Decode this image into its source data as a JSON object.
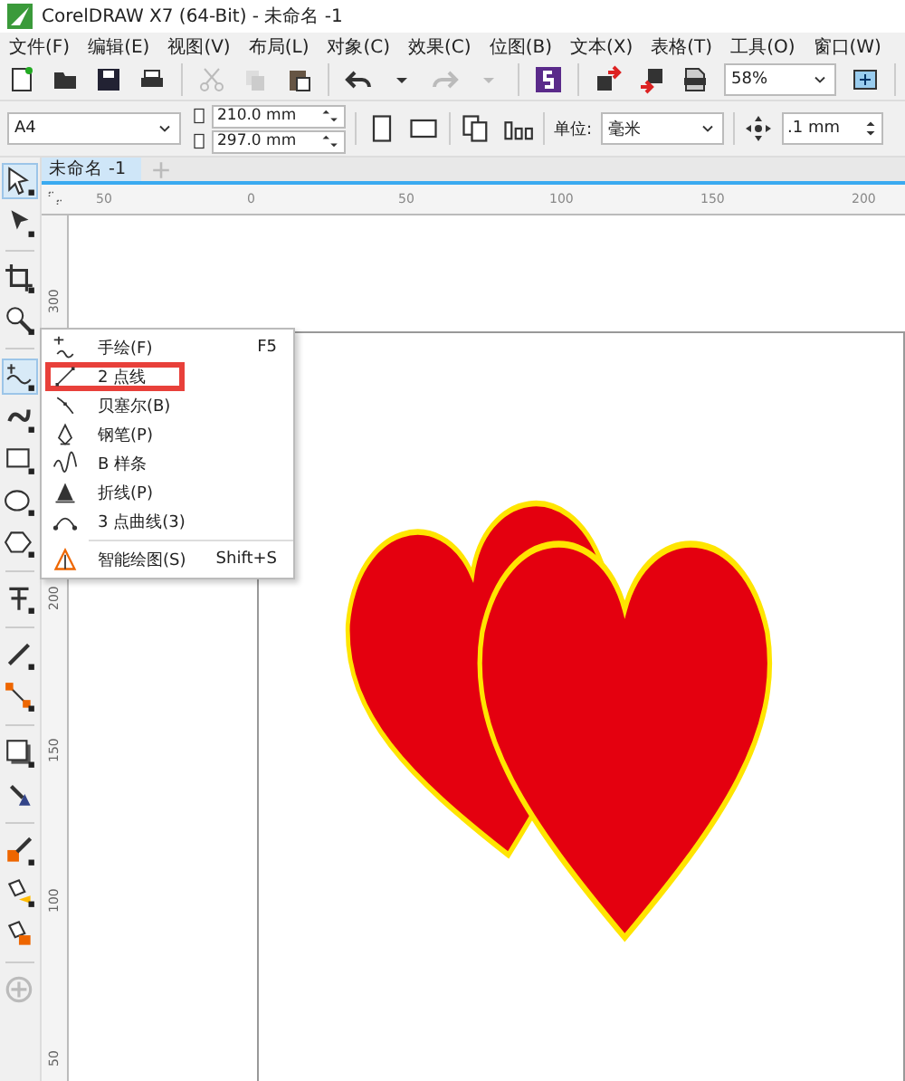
{
  "window": {
    "title": "CorelDRAW X7 (64-Bit) - 未命名 -1"
  },
  "menu_bar": [
    "文件(F)",
    "编辑(E)",
    "视图(V)",
    "布局(L)",
    "对象(C)",
    "效果(C)",
    "位图(B)",
    "文本(X)",
    "表格(T)",
    "工具(O)",
    "窗口(W)"
  ],
  "standard_toolbar": {
    "zoom": "58%"
  },
  "property_bar": {
    "page_size": "A4",
    "width": "210.0 mm",
    "height": "297.0 mm",
    "unit_label": "单位:",
    "unit": "毫米",
    "nudge": ".1 mm"
  },
  "document_tabs": [
    {
      "label": "未命名 -1",
      "selected": true
    }
  ],
  "horizontal_ruler": [
    "50",
    "0",
    "50",
    "100",
    "150",
    "200"
  ],
  "vertical_ruler": [
    "300",
    "200",
    "150",
    "100",
    "50"
  ],
  "flyout_menu": [
    {
      "label": "手绘(F)",
      "shortcut": "F5",
      "selected": false
    },
    {
      "label": "2 点线",
      "selected": true
    },
    {
      "label": "贝塞尔(B)",
      "selected": false
    },
    {
      "label": "钢笔(P)",
      "selected": false
    },
    {
      "label": "B 样条",
      "selected": false
    },
    {
      "label": "折线(P)",
      "selected": false
    },
    {
      "label": "3 点曲线(3)",
      "selected": false
    },
    {
      "label": "智能绘图(S)",
      "shortcut": "Shift+S",
      "selected": false,
      "separator_before": true
    }
  ]
}
